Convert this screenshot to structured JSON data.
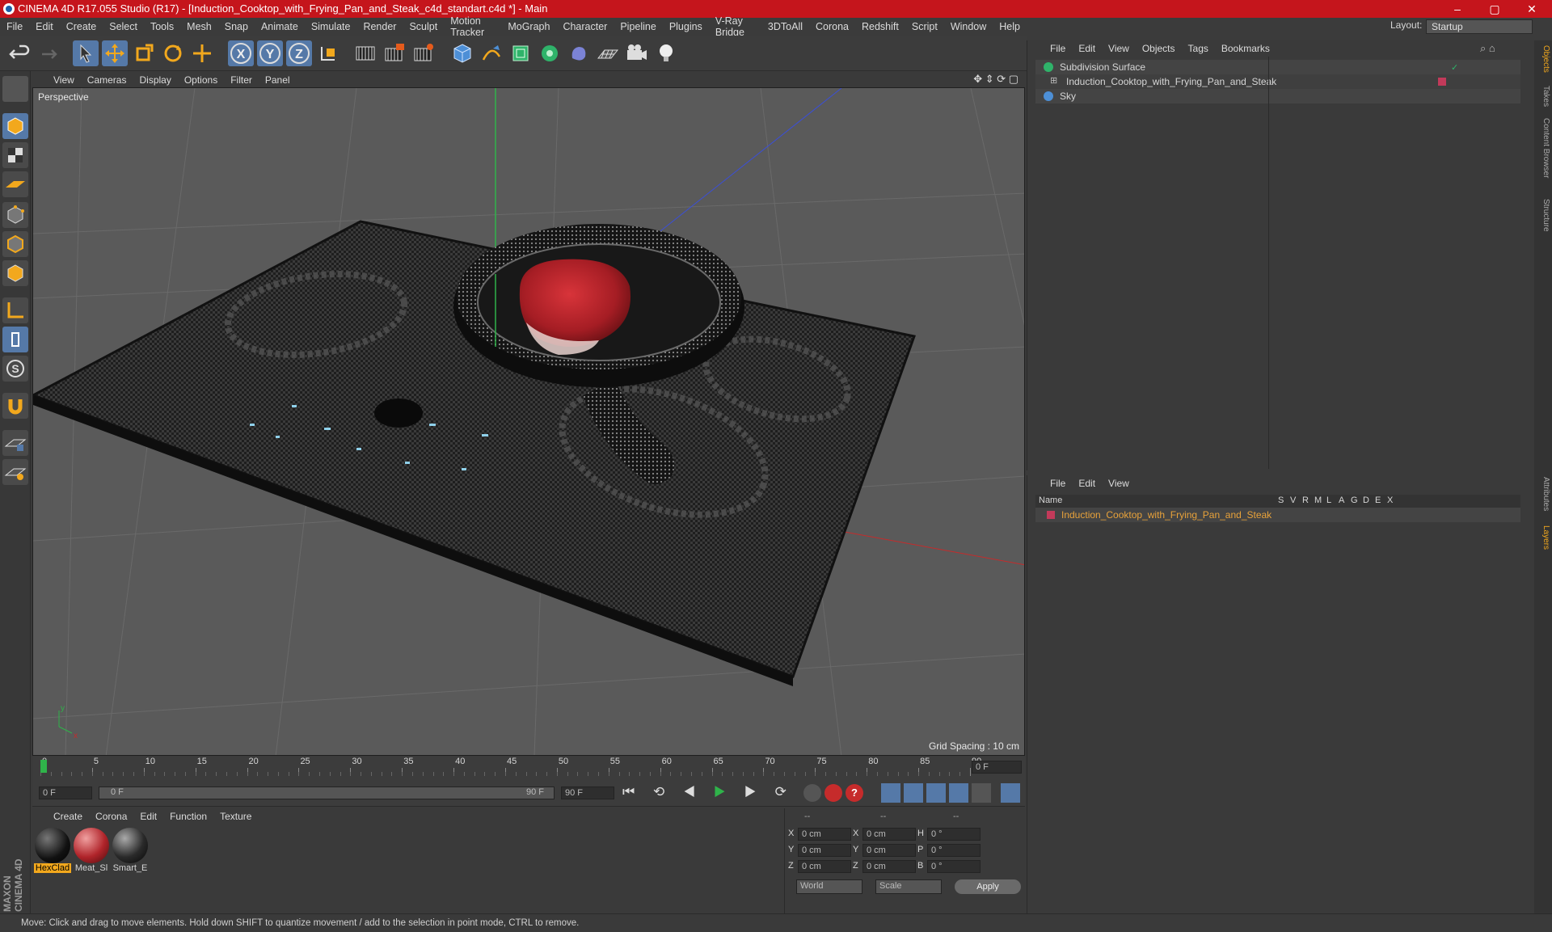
{
  "window": {
    "title": "CINEMA 4D R17.055 Studio (R17) - [Induction_Cooktop_with_Frying_Pan_and_Steak_c4d_standart.c4d *] - Main",
    "controls": [
      "–",
      "▢",
      "✕"
    ]
  },
  "menubar": {
    "items": [
      "File",
      "Edit",
      "Create",
      "Select",
      "Tools",
      "Mesh",
      "Snap",
      "Animate",
      "Simulate",
      "Render",
      "Sculpt",
      "Motion Tracker",
      "MoGraph",
      "Character",
      "Pipeline",
      "Plugins",
      "V-Ray Bridge",
      "3DToAll",
      "Corona",
      "Redshift",
      "Script",
      "Window",
      "Help"
    ],
    "layout_label": "Layout:",
    "layout_value": "Startup"
  },
  "toolbar": {
    "axis": [
      "X",
      "Y",
      "Z"
    ]
  },
  "viewport": {
    "menu": [
      "View",
      "Cameras",
      "Display",
      "Options",
      "Filter",
      "Panel"
    ],
    "label": "Perspective",
    "grid_spacing": "Grid Spacing : 10 cm"
  },
  "timeline": {
    "ticks": [
      "0",
      "5",
      "10",
      "15",
      "20",
      "25",
      "30",
      "35",
      "40",
      "45",
      "50",
      "55",
      "60",
      "65",
      "70",
      "75",
      "80",
      "85",
      "90"
    ],
    "current": "0 F",
    "start": "0 F",
    "range_start": "0 F",
    "range_end": "90 F",
    "end": "90 F"
  },
  "materials": {
    "menu": [
      "Create",
      "Corona",
      "Edit",
      "Function",
      "Texture"
    ],
    "items": [
      {
        "name": "HexClad",
        "color": "#1a1a1a"
      },
      {
        "name": "Meat_Sl",
        "color": "#b0242a"
      },
      {
        "name": "Smart_E",
        "color": "#2a2a2a"
      }
    ]
  },
  "coords": {
    "header": [
      "--",
      "--",
      "--"
    ],
    "rows": [
      {
        "a": "X",
        "av": "0 cm",
        "b": "X",
        "bv": "0 cm",
        "c": "H",
        "cv": "0 °"
      },
      {
        "a": "Y",
        "av": "0 cm",
        "b": "Y",
        "bv": "0 cm",
        "c": "P",
        "cv": "0 °"
      },
      {
        "a": "Z",
        "av": "0 cm",
        "b": "Z",
        "bv": "0 cm",
        "c": "B",
        "cv": "0 °"
      }
    ],
    "world": "World",
    "scale": "Scale",
    "apply": "Apply"
  },
  "objects": {
    "menu": [
      "File",
      "Edit",
      "View",
      "Objects",
      "Tags",
      "Bookmarks"
    ],
    "items": [
      {
        "name": "Subdivision Surface",
        "color": "#d0d0d0"
      },
      {
        "name": "Induction_Cooktop_with_Frying_Pan_and_Steak",
        "color": "#d0d0d0"
      },
      {
        "name": "Sky",
        "color": "#d0d0d0"
      }
    ]
  },
  "layers": {
    "menu": [
      "File",
      "Edit",
      "View"
    ],
    "col_name": "Name",
    "cols": [
      "S",
      "V",
      "R",
      "M",
      "L",
      "A",
      "G",
      "D",
      "E",
      "X"
    ],
    "item": "Induction_Cooktop_with_Frying_Pan_and_Steak",
    "item_color": "#e8a23a"
  },
  "sidetabs": [
    "Objects",
    "Takes",
    "Content Browser",
    "Structure",
    "Attributes",
    "Layers"
  ],
  "brand": "MAXON CINEMA 4D",
  "status": "Move: Click and drag to move elements. Hold down SHIFT to quantize movement / add to the selection in point mode, CTRL to remove."
}
